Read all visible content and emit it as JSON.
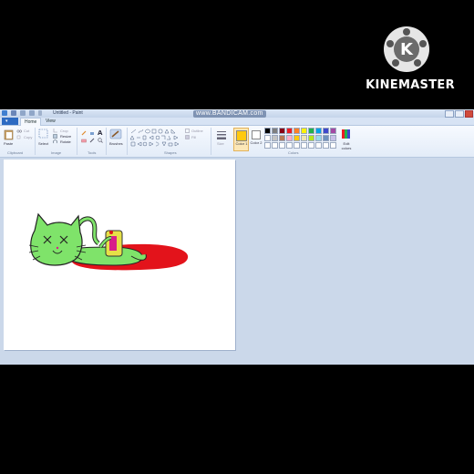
{
  "watermark_app": {
    "name": "KINEMASTER",
    "icon": "kinemaster-k-logo-icon"
  },
  "window": {
    "title": "Untitled - Paint",
    "recorder_watermark": "www.BANDICAM.com"
  },
  "tabs": {
    "file": "▾",
    "home": "Home",
    "view": "View"
  },
  "ribbon": {
    "clipboard": {
      "paste": "Paste",
      "cut": "Cut",
      "copy": "Copy",
      "group": "Clipboard"
    },
    "image": {
      "crop": "Crop",
      "resize": "Resize",
      "select": "Select",
      "rotate": "Rotate",
      "group": "Image"
    },
    "tools": {
      "group": "Tools"
    },
    "brushes": {
      "label": "Brushes"
    },
    "shapes": {
      "outline": "Outline",
      "fill": "Fill",
      "group": "Shapes"
    },
    "size": {
      "label": "Size"
    },
    "color1": {
      "label": "Color 1"
    },
    "color2": {
      "label": "Color 2"
    },
    "colors": {
      "group": "Colors",
      "edit": "Edit colors"
    }
  },
  "palette": {
    "row1": [
      "#000000",
      "#7f7f7f",
      "#880015",
      "#ed1c24",
      "#ff7f27",
      "#fff200",
      "#22b14c",
      "#00a2e8",
      "#3f48cc",
      "#a349a4"
    ],
    "row2": [
      "#ffffff",
      "#c3c3c3",
      "#b97a57",
      "#ffaec9",
      "#ffc90e",
      "#efe4b0",
      "#b5e61d",
      "#99d9ea",
      "#7092be",
      "#c8bfe7"
    ],
    "row3": [
      "#ffffff",
      "#ffffff",
      "#ffffff",
      "#ffffff",
      "#ffffff",
      "#ffffff",
      "#ffffff",
      "#ffffff",
      "#ffffff",
      "#ffffff"
    ],
    "color1_value": "#ffc90e",
    "color2_value": "#ffffff"
  },
  "drawing_colors": {
    "cat": "#7fe36a",
    "blood": "#e3131b",
    "can": "#e6e047",
    "accent": "#d81f8a"
  }
}
